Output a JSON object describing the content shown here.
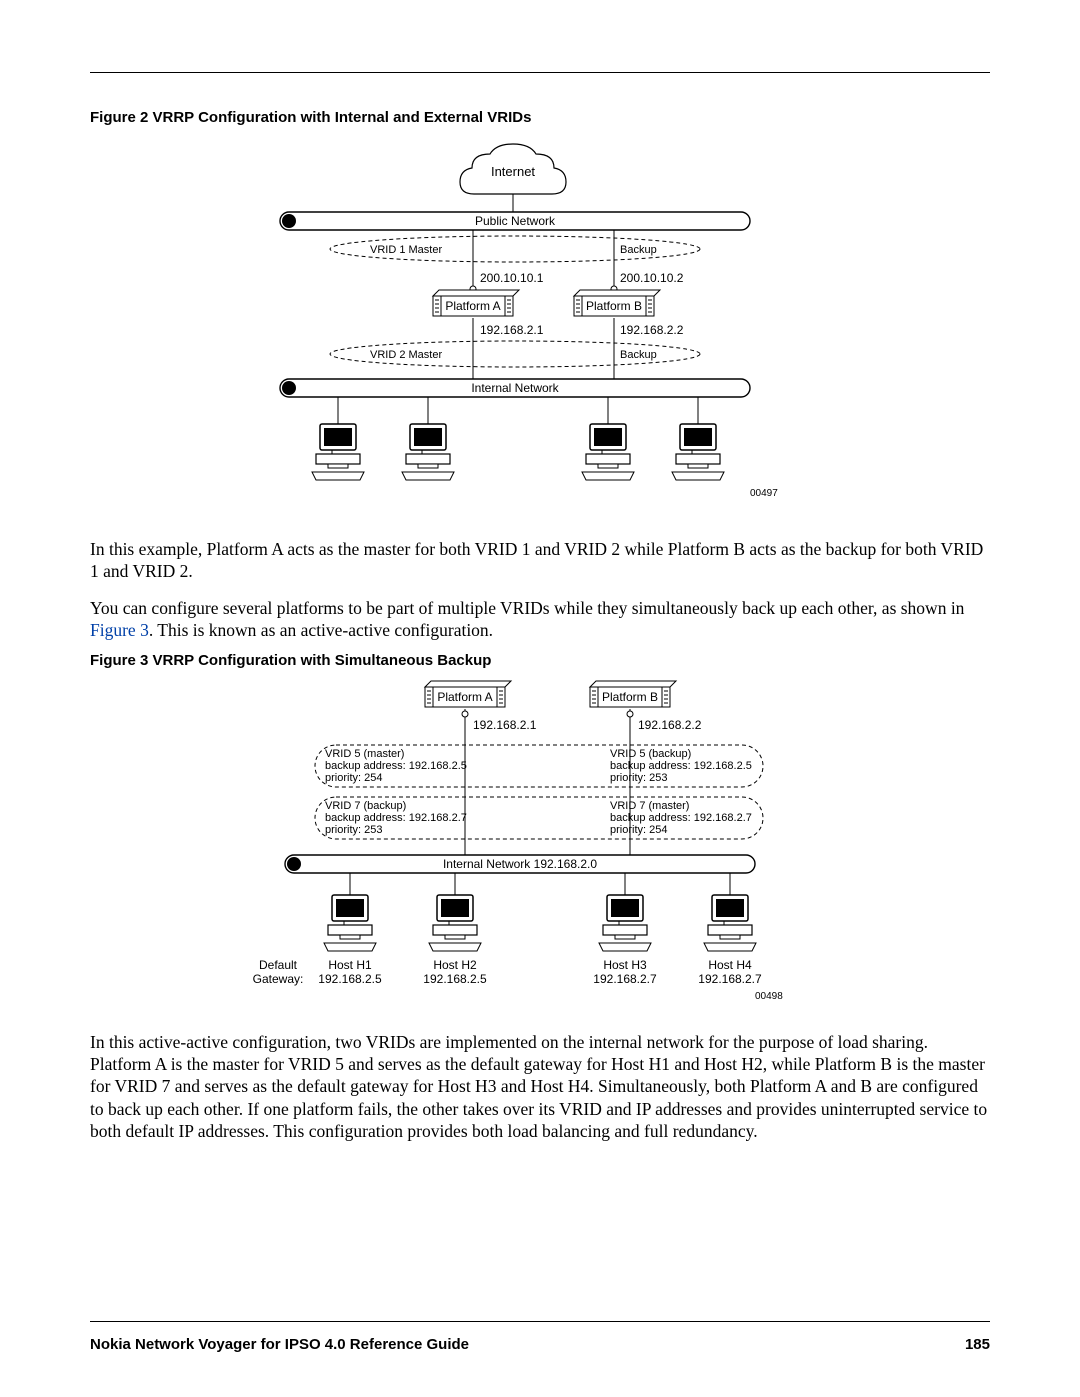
{
  "fig2": {
    "title": "Figure 2  VRRP Configuration with Internal and External VRIDs",
    "internet": "Internet",
    "public_network": "Public Network",
    "vrid1": "VRID 1 Master",
    "backup_top": "Backup",
    "ip_a_top": "200.10.10.1",
    "ip_b_top": "200.10.10.2",
    "platform_a": "Platform A",
    "platform_b": "Platform B",
    "ip_a_bot": "192.168.2.1",
    "ip_b_bot": "192.168.2.2",
    "vrid2": "VRID 2 Master",
    "backup_bot": "Backup",
    "internal_network": "Internal Network",
    "code": "00497"
  },
  "para1": "In this example, Platform A acts as the master for both VRID 1 and VRID 2 while Platform B acts as the backup for both VRID 1 and VRID 2.",
  "para2a": "You can configure several platforms to be part of multiple VRIDs while they simultaneously back up each other, as shown in ",
  "para2_link": "Figure 3",
  "para2b": ". This is known as an active-active configuration.",
  "fig3": {
    "title": "Figure 3  VRRP Configuration with Simultaneous Backup",
    "platform_a": "Platform A",
    "platform_b": "Platform B",
    "ip_a": "192.168.2.1",
    "ip_b": "192.168.2.2",
    "a5_l1": "VRID 5 (master)",
    "a5_l2": "backup address: 192.168.2.5",
    "a5_l3": "priority: 254",
    "b5_l1": "VRID 5 (backup)",
    "b5_l2": "backup address: 192.168.2.5",
    "b5_l3": "priority: 253",
    "a7_l1": "VRID 7 (backup)",
    "a7_l2": "backup address: 192.168.2.7",
    "a7_l3": "priority: 253",
    "b7_l1": "VRID 7 (master)",
    "b7_l2": "backup address: 192.168.2.7",
    "b7_l3": "priority: 254",
    "internal": "Internal Network 192.168.2.0",
    "default": "Default",
    "gateway": "Gateway:",
    "h1": "Host H1",
    "h1_ip": "192.168.2.5",
    "h2": "Host H2",
    "h2_ip": "192.168.2.5",
    "h3": "Host H3",
    "h3_ip": "192.168.2.7",
    "h4": "Host H4",
    "h4_ip": "192.168.2.7",
    "code": "00498"
  },
  "para3": "In this active-active configuration, two VRIDs are implemented on the internal network for the purpose of load sharing. Platform A is the master for VRID 5 and serves as the default gateway for Host H1 and Host H2, while Platform B is the master for VRID 7 and serves as the default gateway for Host H3 and Host H4. Simultaneously, both Platform A and B are configured to back up each other. If one platform fails, the other takes over its VRID and IP addresses and provides uninterrupted service to both default IP addresses. This configuration provides both load balancing and full redundancy.",
  "footer": {
    "title": "Nokia Network Voyager for IPSO 4.0 Reference Guide",
    "page": "185"
  }
}
